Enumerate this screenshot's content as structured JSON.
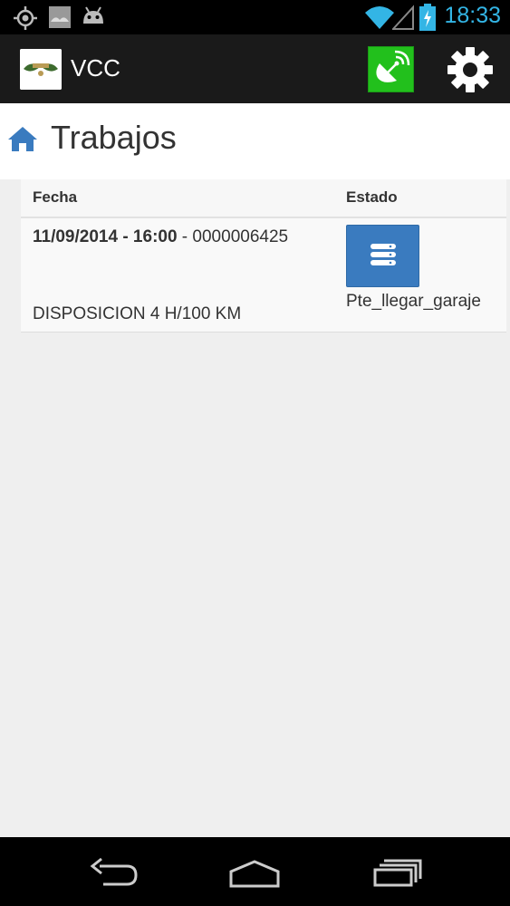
{
  "status_bar": {
    "time": "18:33",
    "icons": [
      "gps-icon",
      "image-icon",
      "android-icon",
      "wifi-icon",
      "signal-icon",
      "battery-charging-icon"
    ]
  },
  "action_bar": {
    "title": "VCC",
    "logo_icon": "app-logo-icon",
    "gps_button_icon": "satellite-dish-icon",
    "gps_button_color": "#22c01c",
    "settings_icon": "gear-icon"
  },
  "page": {
    "icon": "home-icon",
    "title": "Trabajos"
  },
  "table": {
    "headers": {
      "fecha": "Fecha",
      "estado": "Estado"
    },
    "rows": [
      {
        "date": "11/09/2014 - 16:00",
        "separator": " - ",
        "code": "0000006425",
        "description": "DISPOSICION 4 H/100 KM",
        "state_icon": "server-icon",
        "state_label": "Pte_llegar_garaje"
      }
    ]
  },
  "nav_bar": {
    "buttons": [
      "back-icon",
      "home-nav-icon",
      "recent-apps-icon"
    ]
  },
  "colors": {
    "accent_blue": "#3a7bbf",
    "status_time": "#33b5e5"
  }
}
